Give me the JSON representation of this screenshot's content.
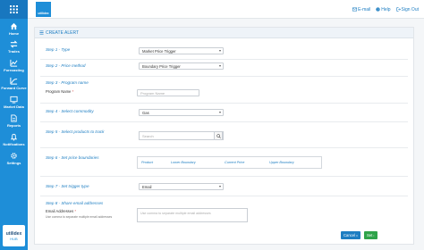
{
  "app": {
    "logo_text": "utilidex",
    "hub_text": "HUB"
  },
  "header": {
    "links": [
      {
        "label": "E-mail",
        "icon": "envelope-icon"
      },
      {
        "label": "Help",
        "icon": "help-icon"
      },
      {
        "label": "Sign Out",
        "icon": "signout-icon"
      }
    ]
  },
  "sidebar": {
    "items": [
      {
        "label": "Home",
        "icon": "home-icon"
      },
      {
        "label": "Trades",
        "icon": "trades-icon"
      },
      {
        "label": "Forecasting",
        "icon": "forecasting-icon"
      },
      {
        "label": "Forward Curve",
        "icon": "forward-curve-icon"
      },
      {
        "label": "Market Data",
        "icon": "market-data-icon"
      },
      {
        "label": "Reports",
        "icon": "reports-icon"
      },
      {
        "label": "Notifications",
        "icon": "bell-icon"
      },
      {
        "label": "Settings",
        "icon": "gear-icon"
      }
    ]
  },
  "form": {
    "title": "CREATE ALERT",
    "step1": {
      "label": "Step 1 - Type",
      "value": "Market Price Trigger"
    },
    "step2": {
      "label": "Step 2 - Price method",
      "value": "Boundary Price Trigger"
    },
    "step3": {
      "label": "Step 3 - Program name",
      "field_label": "Program Name",
      "required_mark": "*",
      "placeholder": "Program Name"
    },
    "step4": {
      "label": "Step 4 - Select commodity",
      "value": "Gas"
    },
    "step5": {
      "label": "Step 5 - Select products to track",
      "search_placeholder": "Search"
    },
    "step6": {
      "label": "Step 6 - Set price boundaries",
      "columns": [
        "Product",
        "Lower Boundary",
        "Current Price",
        "Upper Boundary"
      ]
    },
    "step7": {
      "label": "Step 7 - Set trigger type",
      "value": "Email"
    },
    "step8": {
      "label": "Step 8 - Share email addresses",
      "field_label": "Email Addresses",
      "required_mark": "*",
      "hint": "Use comma to separate multiple email addresses",
      "placeholder": "Use comma to separate multiple email addresses"
    }
  },
  "buttons": {
    "cancel": "Cancel",
    "set": "Set"
  },
  "colors": {
    "sidebar": "#1e8ed8",
    "accent": "#1e7ec2",
    "set_button": "#2fa34a"
  }
}
